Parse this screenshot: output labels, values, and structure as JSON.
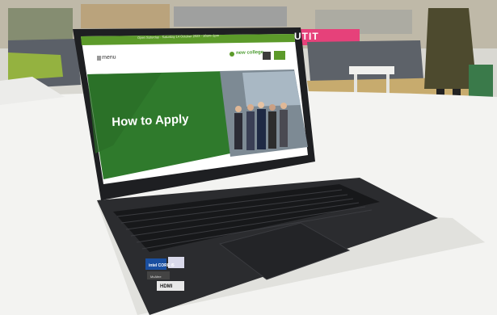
{
  "banner": {
    "text": "Open Saturday · Saturday 14 October 2023 · 10am–1pm"
  },
  "nav": {
    "menu_label": "menu",
    "logo": "new college"
  },
  "hero": {
    "heading": "How to Apply"
  },
  "background": {
    "sign_letters": "UTIT"
  },
  "stickers": {
    "intel": "intel CORE i5",
    "mcafee": "McAfee",
    "hdmi": "HDMI"
  },
  "colors": {
    "site_green": "#2f7a2c",
    "banner_green": "#5c9a2a",
    "laptop_body": "#2b2c2f",
    "table": "#f3f3f1",
    "floor_carpet": "#c7ab6e"
  }
}
